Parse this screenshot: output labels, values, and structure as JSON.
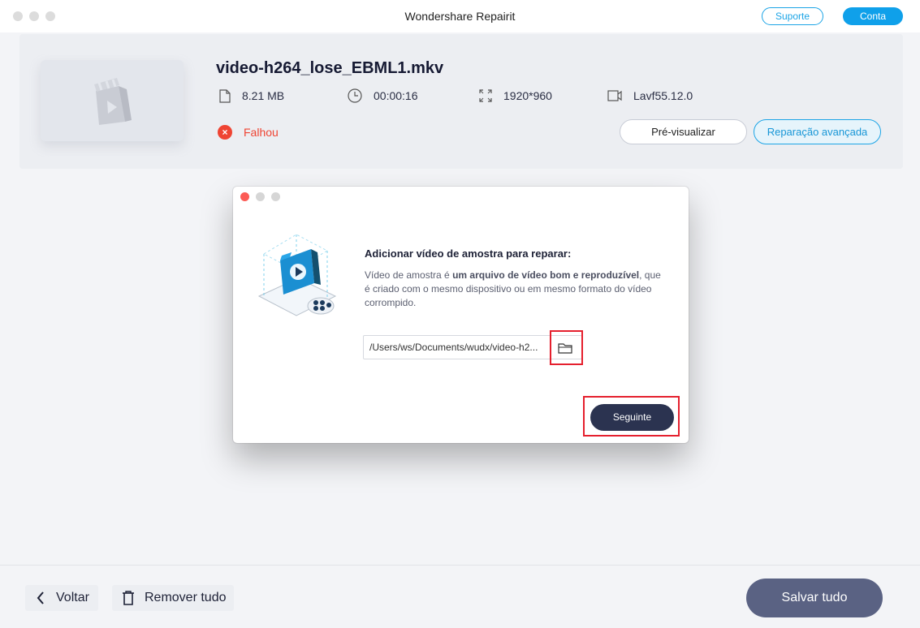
{
  "window": {
    "title": "Wondershare Repairit"
  },
  "header": {
    "support_label": "Suporte",
    "account_label": "Conta"
  },
  "file": {
    "name": "video-h264_lose_EBML1.mkv",
    "size": "8.21 MB",
    "duration": "00:00:16",
    "resolution": "1920*960",
    "encoder": "Lavf55.12.0",
    "status": "Falhou",
    "preview_label": "Pré-visualizar",
    "advanced_label": "Reparação avançada"
  },
  "modal": {
    "title": "Adicionar vídeo de amostra para reparar:",
    "desc_prefix": "Vídeo de amostra é ",
    "desc_bold": "um arquivo de vídeo bom e reproduzível",
    "desc_suffix": ", que é criado com o mesmo dispositivo ou em mesmo formato do vídeo corrompido.",
    "path_value": "/Users/ws/Documents/wudx/video-h2...",
    "next_label": "Seguinte"
  },
  "footer": {
    "back_label": "Voltar",
    "remove_label": "Remover tudo",
    "save_label": "Salvar tudo"
  },
  "colors": {
    "accent": "#0fa0ea",
    "error": "#ef4433",
    "highlight": "#e5202e",
    "primary_dark": "#2b3350",
    "save_button": "#5a6283"
  },
  "icons": {
    "size": "file-icon",
    "duration": "clock-icon",
    "resolution": "expand-icon",
    "encoder": "video-camera-icon",
    "status": "error-x-icon",
    "path_browse": "folder-icon",
    "back": "chevron-left-icon",
    "remove": "trash-icon"
  }
}
